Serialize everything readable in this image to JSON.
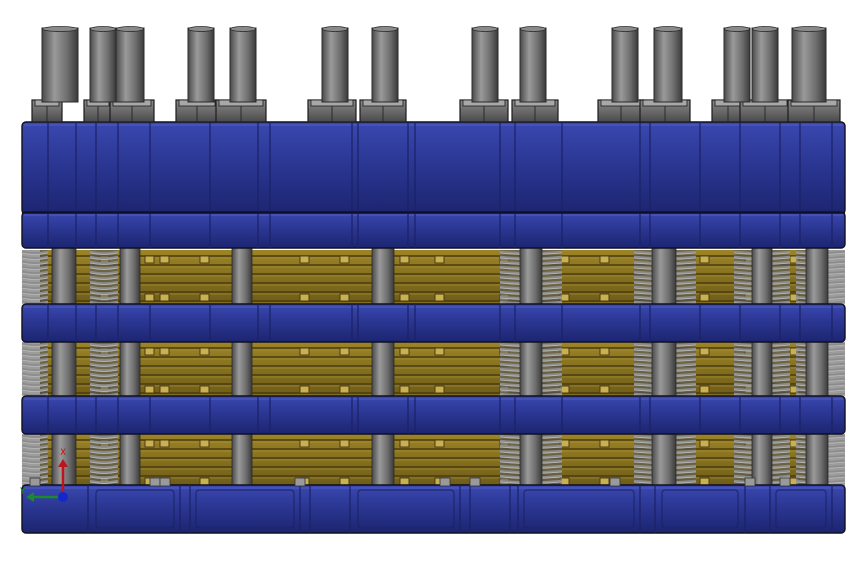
{
  "view": {
    "background": "#ffffff",
    "axis_triad": {
      "x_label": "X",
      "y_label": "Y",
      "x_color": "#c0141c",
      "y_color": "#1a8a2a",
      "z_color": "#1428c8"
    }
  },
  "colors": {
    "plate_blue": "#2a3590",
    "plate_blue_light": "#3a48b0",
    "plate_blue_dark": "#1a2266",
    "cell_gold": "#8a7420",
    "cell_gold_dark": "#4a3c10",
    "cell_gold_light": "#b09a38",
    "rod_gray": "#6e6e6e",
    "rod_gray_light": "#9a9a9a",
    "spring_gray": "#8c8c8c",
    "outline": "#101020"
  },
  "assembly": {
    "name": "",
    "parts": [
      "top-end-plate",
      "middle-plate-1",
      "middle-plate-2",
      "bottom-end-plate",
      "cell-stack",
      "tie-rods",
      "compression-springs",
      "hex-nuts"
    ]
  }
}
